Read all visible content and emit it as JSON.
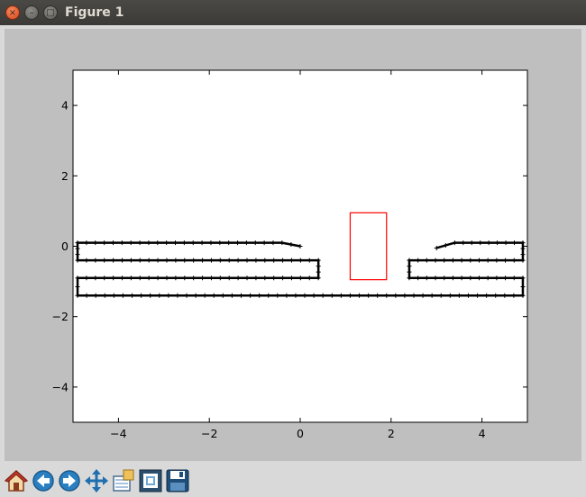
{
  "window": {
    "title": "Figure 1",
    "close_glyph": "×",
    "minimize_glyph": "–",
    "maximize_glyph": "□"
  },
  "toolbar": {
    "buttons": [
      {
        "icon": "home-icon"
      },
      {
        "icon": "back-arrow-icon"
      },
      {
        "icon": "forward-arrow-icon"
      },
      {
        "icon": "pan-move-icon"
      },
      {
        "icon": "zoom-to-rect-icon"
      },
      {
        "icon": "configure-subplots-icon"
      },
      {
        "icon": "save-floppy-icon"
      }
    ]
  },
  "chart_data": {
    "type": "line",
    "title": "",
    "xlabel": "",
    "ylabel": "",
    "xlim": [
      -5,
      5
    ],
    "ylim": [
      -5,
      5
    ],
    "xticks": [
      -4,
      -2,
      0,
      2,
      4
    ],
    "yticks": [
      -4,
      -2,
      0,
      2,
      4
    ],
    "xtick_labels": [
      "−4",
      "−2",
      "0",
      "2",
      "4"
    ],
    "ytick_labels": [
      "−4",
      "−2",
      "0",
      "2",
      "4"
    ],
    "grid": false,
    "colors": {
      "path": "#000000",
      "rectangle": "#ff0000",
      "axes_bg": "#ffffff",
      "figure_bg": "#bfbfbf"
    },
    "series": [
      {
        "marker": "+",
        "x": [
          0.0,
          -0.4,
          -4.9,
          -4.9,
          0.4,
          0.4,
          -4.9,
          -4.9,
          4.9,
          4.9,
          2.4,
          2.4,
          4.9,
          4.9,
          3.4,
          3.0
        ],
        "y": [
          0.0,
          0.1,
          0.1,
          -0.4,
          -0.4,
          -0.9,
          -0.9,
          -1.4,
          -1.4,
          -0.9,
          -0.9,
          -0.4,
          -0.4,
          0.1,
          0.1,
          -0.05
        ]
      }
    ],
    "shapes": [
      {
        "type": "rectangle",
        "x0": 1.1,
        "x1": 1.9,
        "y0": -0.95,
        "y1": 0.95
      }
    ]
  }
}
